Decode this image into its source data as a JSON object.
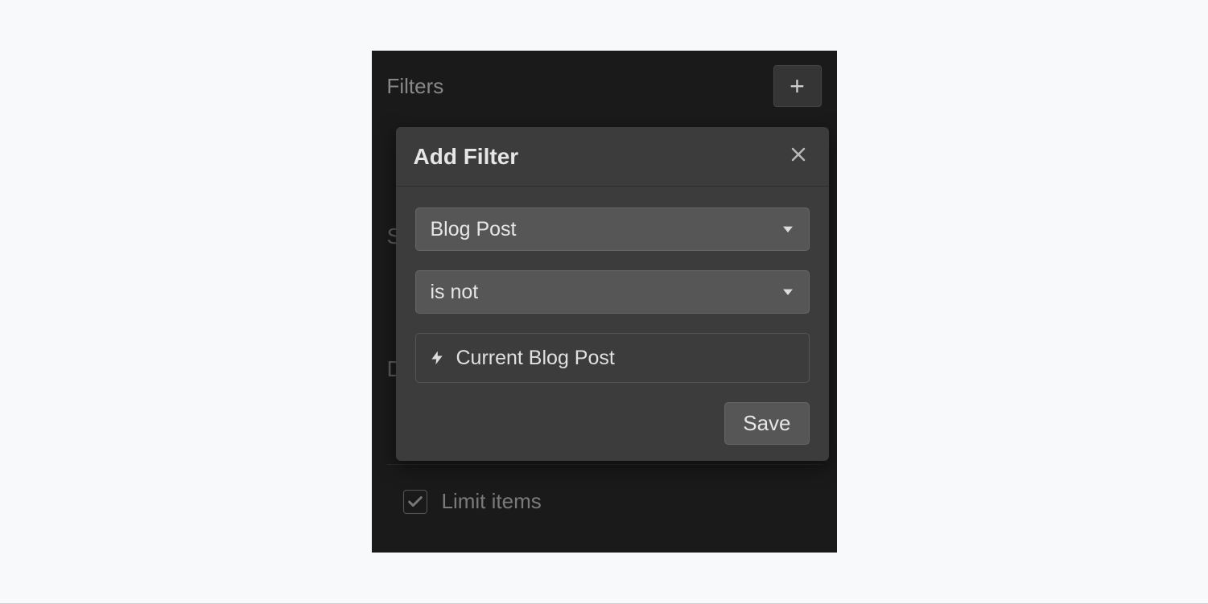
{
  "panel": {
    "title": "Filters",
    "limit_label": "Limit items",
    "limit_checked": true
  },
  "modal": {
    "title": "Add Filter",
    "field_select": "Blog Post",
    "operator_select": "is not",
    "value": "Current Blog Post",
    "save_label": "Save"
  }
}
